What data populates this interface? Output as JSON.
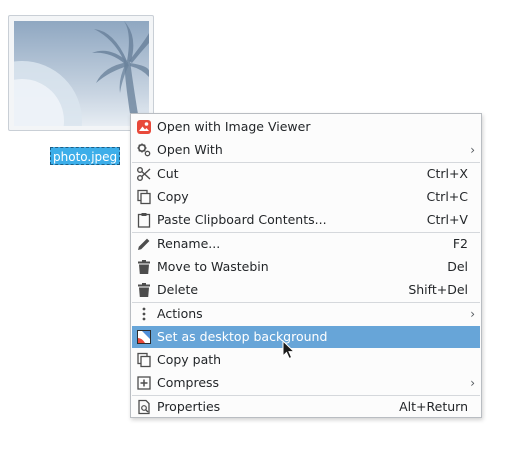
{
  "desktop": {
    "file": {
      "name": "photo.jpeg",
      "thumbnail_icon": "palm-tree-image-thumbnail"
    }
  },
  "context_menu": {
    "items": [
      {
        "label": "Open with Image Viewer",
        "shortcut": "",
        "icon": "image-viewer-icon",
        "submenu": false
      },
      {
        "label": "Open With",
        "shortcut": "",
        "icon": "gear-icon",
        "submenu": true
      },
      {
        "label": "Cut",
        "shortcut": "Ctrl+X",
        "icon": "scissors-icon",
        "submenu": false
      },
      {
        "label": "Copy",
        "shortcut": "Ctrl+C",
        "icon": "copy-icon",
        "submenu": false
      },
      {
        "label": "Paste Clipboard Contents...",
        "shortcut": "Ctrl+V",
        "icon": "clipboard-icon",
        "submenu": false
      },
      {
        "label": "Rename...",
        "shortcut": "F2",
        "icon": "pencil-icon",
        "submenu": false
      },
      {
        "label": "Move to Wastebin",
        "shortcut": "Del",
        "icon": "trash-icon",
        "submenu": false
      },
      {
        "label": "Delete",
        "shortcut": "Shift+Del",
        "icon": "trash-icon",
        "submenu": false
      },
      {
        "label": "Actions",
        "shortcut": "",
        "icon": "vertical-dots-icon",
        "submenu": true
      },
      {
        "label": "Set as desktop background",
        "shortcut": "",
        "icon": "wallpaper-icon",
        "submenu": false,
        "selected": true
      },
      {
        "label": "Copy path",
        "shortcut": "",
        "icon": "copy-icon",
        "submenu": false
      },
      {
        "label": "Compress",
        "shortcut": "",
        "icon": "archive-plus-icon",
        "submenu": true
      },
      {
        "label": "Properties",
        "shortcut": "Alt+Return",
        "icon": "document-search-icon",
        "submenu": false
      }
    ],
    "submenu_arrow": "›"
  },
  "colors": {
    "selection": "#67a5d8",
    "file_label_bg": "#3daee9",
    "menu_bg": "#fcfcfc"
  }
}
